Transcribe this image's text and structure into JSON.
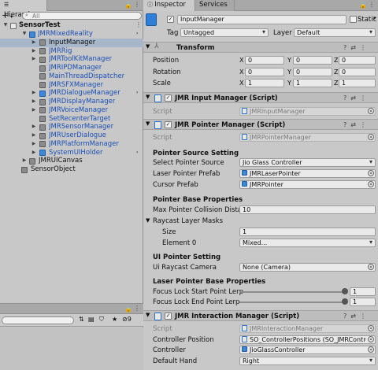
{
  "hierarchy": {
    "tab_label": "Hierarchy",
    "add_label": "+",
    "search_placeholder": "All",
    "scene_label": "SensorTest",
    "items": [
      "JMRMixedReality",
      "InputManager",
      "JMRRig",
      "JMRToolKitManager",
      "JMRIPDManager",
      "MainThreadDispatcher",
      "JMRSFXManager",
      "JMRDialogueManager",
      "JMRDisplayManager",
      "JMRVoiceManager",
      "SetRecenterTarget",
      "JMRSensorManager",
      "JMRUserDialogue",
      "JMRPlatformManager",
      "SystemUIHolder",
      "JMRUICanvas",
      "SensorObject"
    ],
    "bottom_count": "9"
  },
  "inspector": {
    "tab_label": "Inspector",
    "services_tab": "Services",
    "object_name": "InputManager",
    "static_label": "Static",
    "tag_label": "Tag",
    "tag_value": "Untagged",
    "layer_label": "Layer",
    "layer_value": "Default",
    "transform": {
      "title": "Transform",
      "rows": [
        {
          "label": "Position",
          "x": "0",
          "y": "0",
          "z": "0"
        },
        {
          "label": "Rotation",
          "x": "0",
          "y": "0",
          "z": "0"
        },
        {
          "label": "Scale",
          "x": "1",
          "y": "1",
          "z": "1"
        }
      ]
    },
    "axis": {
      "x": "X",
      "y": "Y",
      "z": "Z"
    },
    "input_manager": {
      "title": "JMR Input Manager (Script)",
      "script_label": "Script",
      "script_value": "JMRInputManager"
    },
    "pointer_manager": {
      "title": "JMR Pointer Manager (Script)",
      "script_label": "Script",
      "script_value": "JMRPointerManager",
      "section1": "Pointer Source Setting",
      "select_source_label": "Select Pointer Source",
      "select_source_value": "Jio Glass Controller",
      "laser_prefab_label": "Laser Pointer Prefab",
      "laser_prefab_value": "JMRLaserPointer",
      "cursor_prefab_label": "Cursor Prefab",
      "cursor_prefab_value": "JMRPointer",
      "section2": "Pointer Base Properties",
      "max_dist_label": "Max Pointer Collision Distan",
      "max_dist_value": "10",
      "raycast_masks_label": "Raycast Layer Masks",
      "size_label": "Size",
      "size_value": "1",
      "element0_label": "Element 0",
      "element0_value": "Mixed...",
      "section3": "UI Pointer Setting",
      "ui_camera_label": "Ui Raycast Camera",
      "ui_camera_value": "None (Camera)",
      "section4": "Laser Pointer Base Properties",
      "focus_start_label": "Focus Lock Start Point Lerp",
      "focus_start_value": "1",
      "focus_end_label": "Focus Lock End Point Lerp",
      "focus_end_value": "1"
    },
    "interaction_manager": {
      "title": "JMR Interaction Manager (Script)",
      "script_label": "Script",
      "script_value": "JMRInteractionManager",
      "ctrl_pos_label": "Controller Position",
      "ctrl_pos_value": "SO_ControllerPositions (SO_JMRControl",
      "controller_label": "Controller",
      "controller_value": "JioGlassController",
      "hand_label": "Default Hand",
      "hand_value": "Right"
    }
  }
}
